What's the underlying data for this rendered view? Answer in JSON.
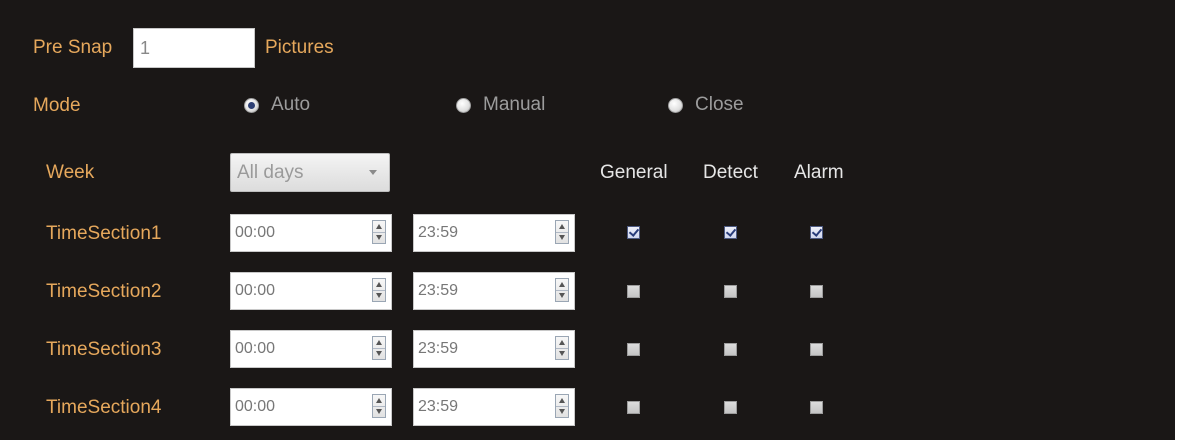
{
  "pre_snap": {
    "label": "Pre Snap",
    "value": "1",
    "unit": "Pictures"
  },
  "mode": {
    "label": "Mode",
    "options": [
      {
        "label": "Auto",
        "checked": true
      },
      {
        "label": "Manual",
        "checked": false
      },
      {
        "label": "Close",
        "checked": false
      }
    ]
  },
  "week": {
    "label": "Week",
    "selected": "All days"
  },
  "columns": {
    "general": "General",
    "detect": "Detect",
    "alarm": "Alarm"
  },
  "sections": [
    {
      "label": "TimeSection1",
      "start": "00:00",
      "end": "23:59",
      "general": true,
      "detect": true,
      "alarm": true
    },
    {
      "label": "TimeSection2",
      "start": "00:00",
      "end": "23:59",
      "general": false,
      "detect": false,
      "alarm": false
    },
    {
      "label": "TimeSection3",
      "start": "00:00",
      "end": "23:59",
      "general": false,
      "detect": false,
      "alarm": false
    },
    {
      "label": "TimeSection4",
      "start": "00:00",
      "end": "23:59",
      "general": false,
      "detect": false,
      "alarm": false
    }
  ],
  "colors": {
    "panel_bg": "#1a1716",
    "label": "#e6a85c",
    "column_header": "#e6e6e6",
    "radio_text": "#9c9c9c"
  }
}
